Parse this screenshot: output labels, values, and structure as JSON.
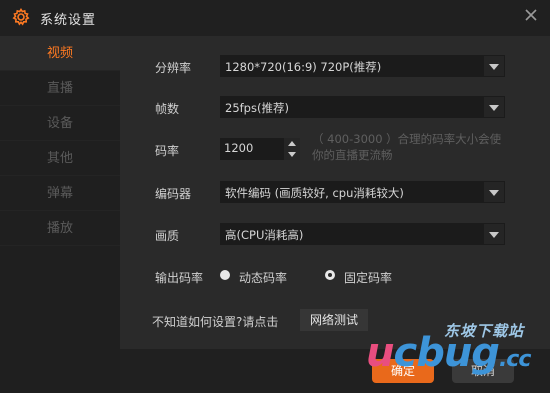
{
  "window": {
    "title": "系统设置",
    "icons": {
      "gear": "gear-icon",
      "close": "close-icon"
    },
    "accent_color": "#ff7a22"
  },
  "sidebar": {
    "items": [
      {
        "label": "视频",
        "active": true
      },
      {
        "label": "直播",
        "active": false
      },
      {
        "label": "设备",
        "active": false
      },
      {
        "label": "其他",
        "active": false
      },
      {
        "label": "弹幕",
        "active": false
      },
      {
        "label": "播放",
        "active": false
      }
    ]
  },
  "video": {
    "resolution": {
      "label": "分辨率",
      "value": "1280*720(16:9) 720P(推荐)"
    },
    "framerate": {
      "label": "帧数",
      "value": "25fps(推荐)"
    },
    "bitrate": {
      "label": "码率",
      "value": "1200",
      "hint_line1": "（ 400-3000 ）合理的码率大小会使",
      "hint_line2": "你的直播更流畅"
    },
    "encoder": {
      "label": "编码器",
      "value": "软件编码 (画质较好, cpu消耗较大)"
    },
    "quality": {
      "label": "画质",
      "value": "高(CPU消耗高)"
    },
    "output_bitrate": {
      "label": "输出码率",
      "options": [
        {
          "label": "动态码率",
          "checked": false
        },
        {
          "label": "固定码率",
          "checked": true
        }
      ]
    },
    "help_text": "不知道如何设置?请点击",
    "network_test_label": "网络测试"
  },
  "footer": {
    "ok_label": "确定",
    "cancel_label": "取消",
    "ok_color": "#e9691b"
  },
  "watermark": {
    "top": "东坡下载站",
    "main_u": "u",
    "main_rest": "cbug",
    "suffix": ".cc"
  }
}
